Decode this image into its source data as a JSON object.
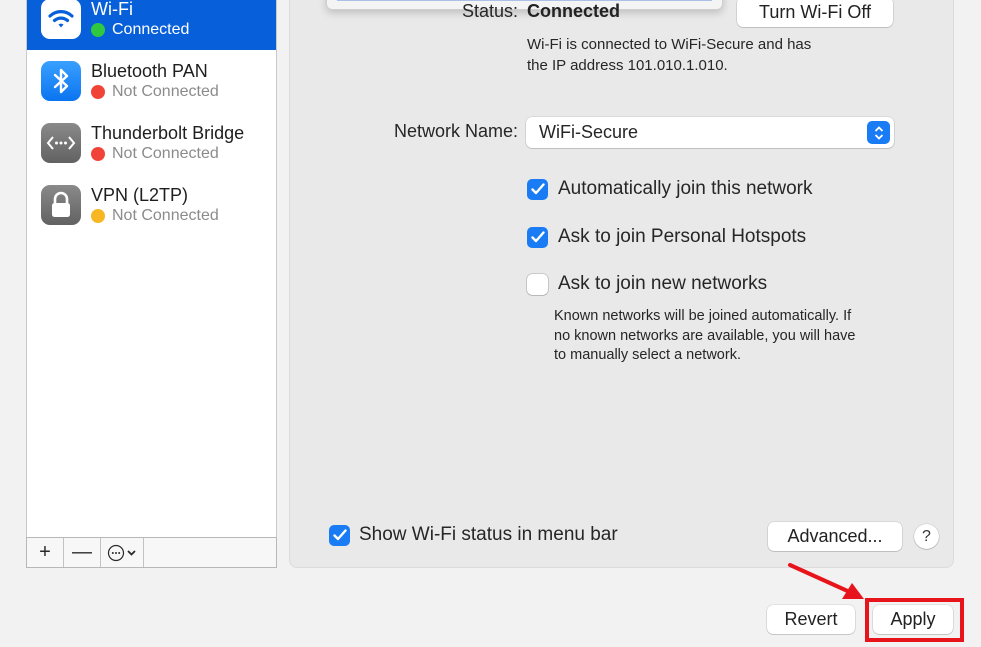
{
  "sidebar": {
    "services": [
      {
        "name": "Wi-Fi",
        "status": "Connected",
        "status_color": "#2fc840",
        "icon": "wifi-icon",
        "selected": true
      },
      {
        "name": "Bluetooth PAN",
        "status": "Not Connected",
        "status_color": "#f04438",
        "icon": "bluetooth-icon",
        "selected": false
      },
      {
        "name": "Thunderbolt Bridge",
        "status": "Not Connected",
        "status_color": "#f04438",
        "icon": "thunderbolt-bridge-icon",
        "selected": false
      },
      {
        "name": "VPN (L2TP)",
        "status": "Not Connected",
        "status_color": "#f8b623",
        "icon": "lock-icon",
        "selected": false
      }
    ],
    "toolbar": {
      "add_label": "+",
      "remove_label": "—",
      "action_icon": "ellipsis-circle-icon"
    }
  },
  "main": {
    "status_label": "Status:",
    "status_value": "Connected",
    "turn_off_button": "Turn Wi-Fi Off",
    "status_description_line1": "Wi-Fi is connected to WiFi-Secure and has",
    "status_description_line2": "the IP address 101.010.1.010.",
    "network_name_label": "Network Name:",
    "network_name_value": "WiFi-Secure",
    "checkboxes": [
      {
        "label": "Automatically join this network",
        "checked": true
      },
      {
        "label": "Ask to join Personal Hotspots",
        "checked": true
      },
      {
        "label": "Ask to join new networks",
        "checked": false
      }
    ],
    "known_networks_note": [
      "Known networks will be joined automatically. If",
      "no known networks are available, you will have",
      "to manually select a network."
    ],
    "show_status_checkbox": {
      "label": "Show Wi-Fi status in menu bar",
      "checked": true
    },
    "advanced_button": "Advanced...",
    "help_button": "?"
  },
  "footer": {
    "revert_button": "Revert",
    "apply_button": "Apply"
  },
  "annotation": {
    "highlight_color": "#e8141b",
    "target": "Apply"
  },
  "colors": {
    "accent": "#1a7cf5",
    "selection": "#0760d9"
  }
}
